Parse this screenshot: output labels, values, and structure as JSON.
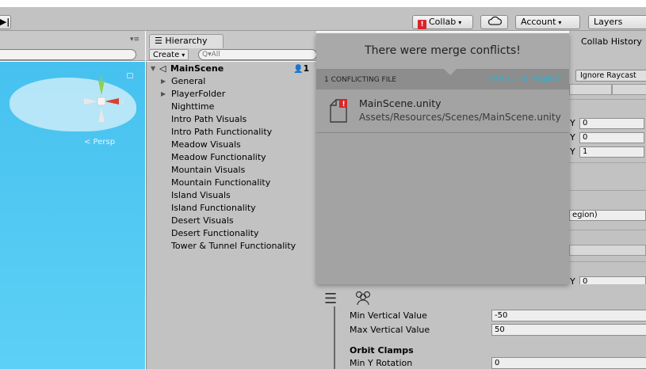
{
  "toolbar": {
    "step_label": "▶|",
    "collab_label": "Collab",
    "account_label": "Account",
    "layers_label": "Layers"
  },
  "scene": {
    "persp_label": "< Persp",
    "gizmo_axis_y": "y",
    "gizmo_axis_x": "x"
  },
  "hierarchy": {
    "tab_label": "Hierarchy",
    "create_label": "Create",
    "search_placeholder": "Q▾All",
    "root": {
      "label": "MainScene",
      "users": "1"
    },
    "items": [
      {
        "label": "General",
        "expandable": true
      },
      {
        "label": "PlayerFolder",
        "expandable": true
      },
      {
        "label": "Nighttime",
        "expandable": false
      },
      {
        "label": "Intro Path Visuals",
        "expandable": false
      },
      {
        "label": "Intro Path Functionality",
        "expandable": false
      },
      {
        "label": "Meadow Visuals",
        "expandable": false
      },
      {
        "label": "Meadow Functionality",
        "expandable": false
      },
      {
        "label": "Mountain Visuals",
        "expandable": false
      },
      {
        "label": "Mountain Functionality",
        "expandable": false
      },
      {
        "label": "Island Visuals",
        "expandable": false
      },
      {
        "label": "Island Functionality",
        "expandable": false
      },
      {
        "label": "Desert Visuals",
        "expandable": false
      },
      {
        "label": "Desert Functionality",
        "expandable": false
      },
      {
        "label": "Tower & Tunnel Functionality",
        "expandable": false
      }
    ]
  },
  "inspector": {
    "collab_history": "Collab History",
    "ignore_raycast": "Ignore Raycast",
    "y_label": "Y",
    "y_values": [
      "0",
      "0",
      "1"
    ],
    "region_text": "egion)",
    "y4_value": "0"
  },
  "popup": {
    "title": "There were merge conflicts!",
    "conflict_count": "1 CONFLICTING FILE",
    "see_all": "SEE ALL IN PROJECT",
    "file_name": "MainScene.unity",
    "file_path": "Assets/Resources/Scenes/MainScene.unity"
  },
  "properties": {
    "min_vertical_label": "Min Vertical Value",
    "min_vertical_value": "-50",
    "max_vertical_label": "Max Vertical Value",
    "max_vertical_value": "50",
    "orbit_clamps_label": "Orbit Clamps",
    "min_y_rotation_label": "Min Y Rotation",
    "min_y_rotation_value": "0"
  },
  "colors": {
    "scene_sky": "#46c1ef",
    "warning_red": "#d8262b",
    "link_cyan": "#22b4d6",
    "user_orange": "#e47b0e"
  }
}
